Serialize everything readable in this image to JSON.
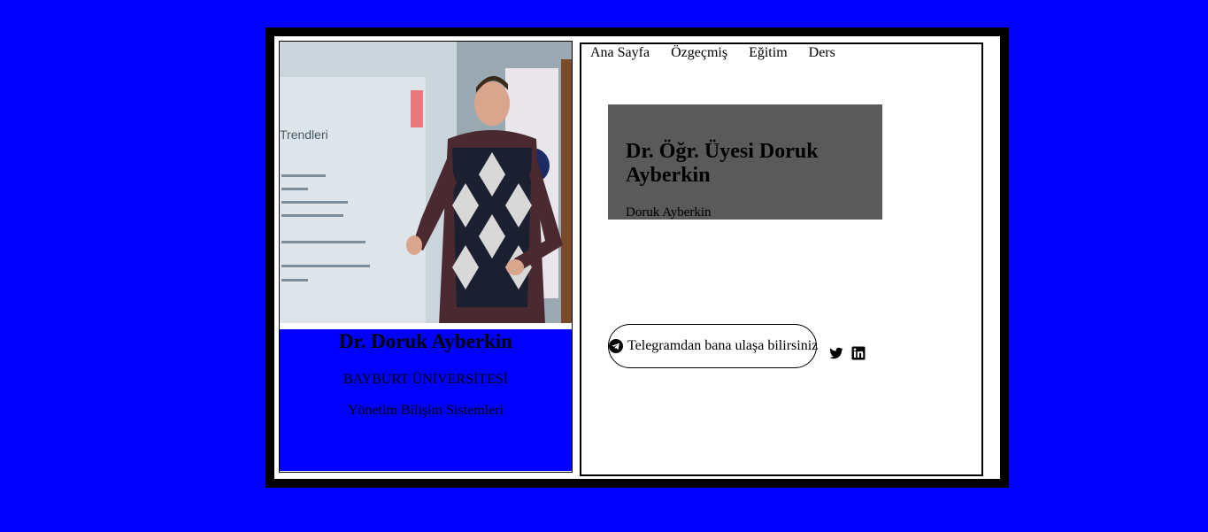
{
  "profile": {
    "name": "Dr. Doruk Ayberkin",
    "university": "BAYBURT ÜNİVERSİTESİ",
    "department": "Yönetim Bilişim Sistemleri",
    "photo_slide_text": "Trendleri"
  },
  "nav": {
    "items": [
      {
        "label": "Ana Sayfa"
      },
      {
        "label": "Özgeçmiş"
      },
      {
        "label": "Eğitim"
      },
      {
        "label": "Ders"
      }
    ]
  },
  "hero": {
    "title": "Dr. Öğr. Üyesi Doruk Ayberkin",
    "subtitle": "Doruk Ayberkin"
  },
  "contact": {
    "telegram_label": "Telegramdan bana ulaşa bilirsiniz",
    "icons": [
      "telegram-icon",
      "twitter-icon",
      "linkedin-icon"
    ]
  },
  "colors": {
    "page_background": "#0000ff",
    "frame": "#000000",
    "hero_background": "#5a5a5a"
  }
}
